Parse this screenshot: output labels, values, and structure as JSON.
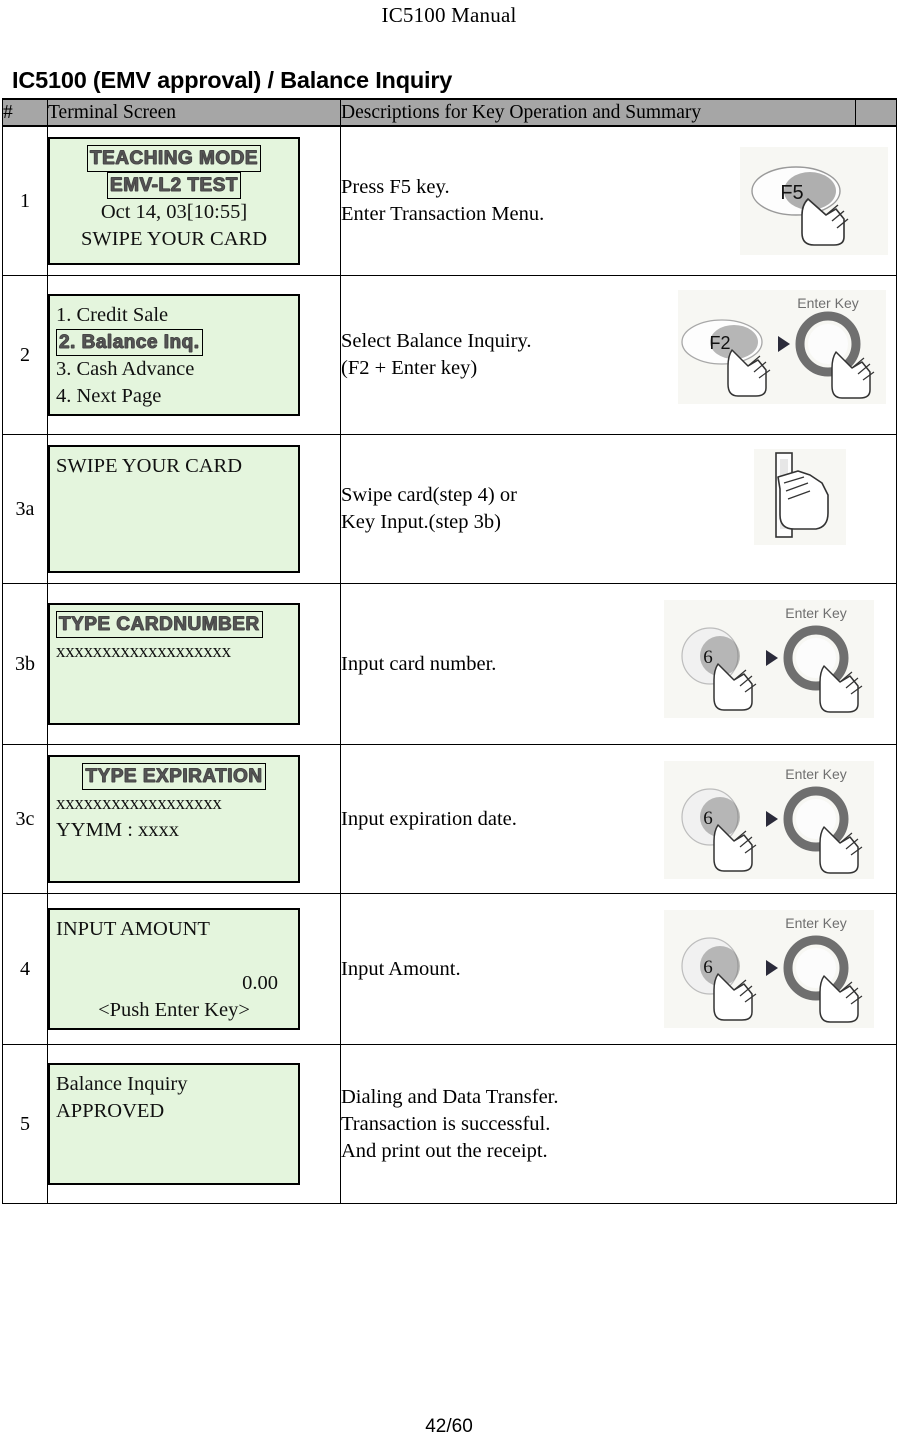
{
  "document": {
    "running_head": "IC5100 Manual",
    "section_title": "IC5100 (EMV approval) / Balance Inquiry",
    "page_number": "42/60"
  },
  "table": {
    "headers": {
      "num": "#",
      "screen": "Terminal Screen",
      "desc": "Descriptions for Key Operation and Summary"
    },
    "rows": [
      {
        "num": "1",
        "screen_lines": [
          "TEACHING MODE",
          "EMV-L2 TEST",
          "Oct 14, 03[10:55]",
          "SWIPE YOUR CARD"
        ],
        "desc": "Press F5 key.\nEnter Transaction Menu.",
        "artwork": "f5-key-press"
      },
      {
        "num": "2",
        "screen_lines": [
          "1. Credit Sale",
          "2. Balance Inq.",
          "3. Cash Advance",
          "4. Next Page"
        ],
        "desc": "Select Balance Inquiry.\n(F2 + Enter key)",
        "artwork": "f2-plus-enter-key"
      },
      {
        "num": "3a",
        "screen_lines": [
          "SWIPE YOUR CARD"
        ],
        "desc": "Swipe card(step 4) or\nKey Input.(step 3b)",
        "artwork": "hand-swipe-card"
      },
      {
        "num": "3b",
        "screen_lines": [
          "TYPE CARDNUMBER",
          "xxxxxxxxxxxxxxxxxxx"
        ],
        "desc": "Input card number.",
        "artwork": "six-plus-enter-key"
      },
      {
        "num": "3c",
        "screen_lines": [
          "TYPE EXPIRATION",
          "xxxxxxxxxxxxxxxxxx",
          "YYMM : xxxx"
        ],
        "desc": "Input expiration date.",
        "artwork": "six-plus-enter-key"
      },
      {
        "num": "4",
        "screen_lines": [
          "INPUT AMOUNT",
          "0.00",
          "<Push Enter Key>"
        ],
        "desc": "Input Amount.",
        "artwork": "six-plus-enter-key"
      },
      {
        "num": "5",
        "screen_lines": [
          "Balance Inquiry",
          "APPROVED"
        ],
        "desc": "Dialing and Data Transfer.\nTransaction is successful.\nAnd print out the receipt.",
        "artwork": "none"
      }
    ]
  },
  "artwork_labels": {
    "f5": "F5",
    "f2": "F2",
    "six": "6",
    "enter_key": "Enter Key"
  },
  "colors": {
    "lcd_background": "#e4f5dd",
    "header_background": "#a6a6a6",
    "border": "#000000",
    "artwork_background": "#f7f7f3"
  }
}
